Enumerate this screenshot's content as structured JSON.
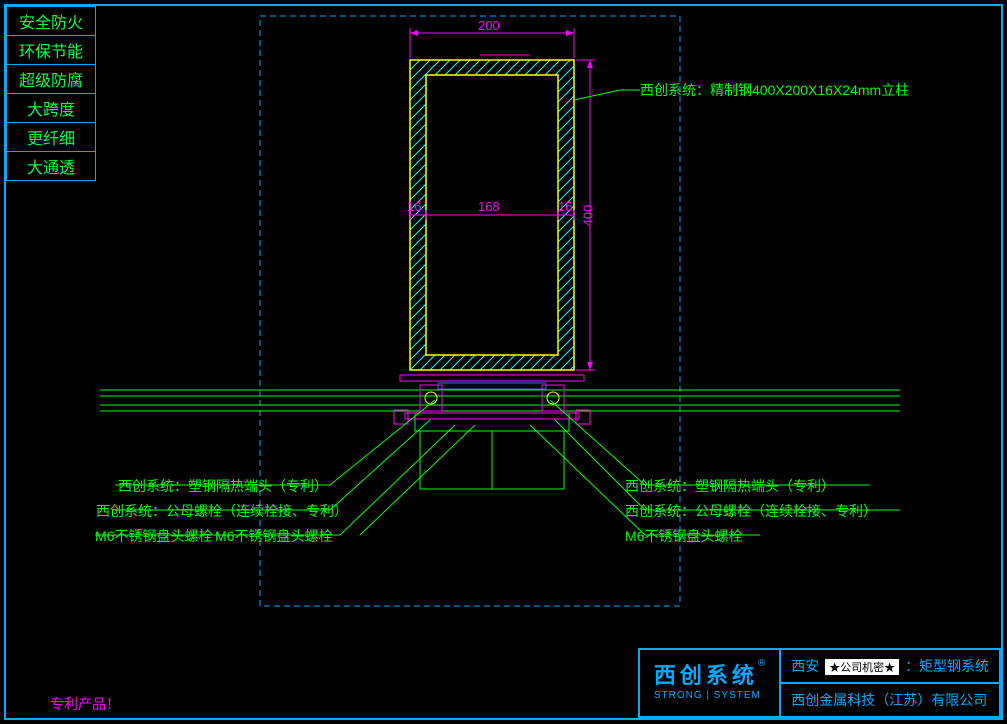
{
  "sidebar": {
    "items": [
      "安全防火",
      "环保节能",
      "超级防腐",
      "大跨度",
      "更纤细",
      "大通透"
    ]
  },
  "dimensions": {
    "top_width": "200",
    "inner_left": "16",
    "inner_mid": "168",
    "inner_right": "16",
    "height": "400"
  },
  "annotations": {
    "column": "西创系统：精制钢400X200X16X24mm立柱",
    "thermal_left": "西创系统：塑钢隔热端头（专利）",
    "thermal_right": "西创系统：塑钢隔热端头（专利）",
    "bolt_left": "西创系统：公母螺栓（连续栓接、专利）",
    "bolt_right": "西创系统：公母螺栓（连续栓接、专利）",
    "m6_left_a": "M6不锈钢盘头螺栓",
    "m6_left_b": "M6不锈钢盘头螺栓",
    "m6_right": "M6不锈钢盘头螺栓"
  },
  "patent_note": "专利产品！",
  "titleblock": {
    "logo_main": "西创系统",
    "logo_reg": "®",
    "logo_sub": "STRONG | SYSTEM",
    "top_prefix": "西安",
    "confidential": "★公司机密★",
    "top_suffix": "：矩型钢系统",
    "bottom": "西创金属科技（江苏）有限公司"
  }
}
